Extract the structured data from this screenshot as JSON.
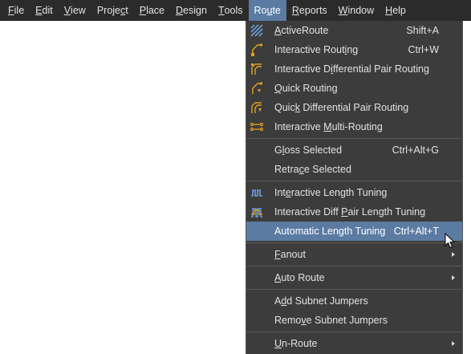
{
  "menubar": {
    "items": [
      {
        "pre": "",
        "ul": "F",
        "post": "ile"
      },
      {
        "pre": "",
        "ul": "E",
        "post": "dit"
      },
      {
        "pre": "",
        "ul": "V",
        "post": "iew"
      },
      {
        "pre": "Proje",
        "ul": "c",
        "post": "t"
      },
      {
        "pre": "",
        "ul": "P",
        "post": "lace"
      },
      {
        "pre": "",
        "ul": "D",
        "post": "esign"
      },
      {
        "pre": "",
        "ul": "T",
        "post": "ools"
      },
      {
        "pre": "Ro",
        "ul": "u",
        "post": "te"
      },
      {
        "pre": "",
        "ul": "R",
        "post": "eports"
      },
      {
        "pre": "",
        "ul": "W",
        "post": "indow"
      },
      {
        "pre": "",
        "ul": "H",
        "post": "elp"
      }
    ]
  },
  "route_menu": {
    "items": [
      {
        "pre": "",
        "ul": "A",
        "post": "ctiveRoute",
        "shortcut": "Shift+A",
        "icon": "active-route-icon"
      },
      {
        "pre": "Interactive Rout",
        "ul": "i",
        "post": "ng",
        "shortcut": "Ctrl+W",
        "icon": "interactive-routing-icon"
      },
      {
        "pre": "Interactive D",
        "ul": "i",
        "post": "fferential Pair Routing",
        "shortcut": "",
        "icon": "diff-pair-routing-icon"
      },
      {
        "pre": "",
        "ul": "Q",
        "post": "uick Routing",
        "shortcut": "",
        "icon": "quick-routing-icon"
      },
      {
        "pre": "Quic",
        "ul": "k",
        "post": " Differential Pair Routing",
        "shortcut": "",
        "icon": "quick-diff-pair-routing-icon"
      },
      {
        "pre": "Interactive ",
        "ul": "M",
        "post": "ulti-Routing",
        "shortcut": "",
        "icon": "multi-routing-icon"
      },
      {
        "pre": "G",
        "ul": "l",
        "post": "oss Selected",
        "shortcut": "Ctrl+Alt+G",
        "icon": ""
      },
      {
        "pre": "Retra",
        "ul": "c",
        "post": "e Selected",
        "shortcut": "",
        "icon": ""
      },
      {
        "pre": "Int",
        "ul": "e",
        "post": "ractive Length Tuning",
        "shortcut": "",
        "icon": "length-tuning-icon"
      },
      {
        "pre": "Interactive Diff ",
        "ul": "P",
        "post": "air Length Tuning",
        "shortcut": "",
        "icon": "diff-pair-length-tuning-icon"
      },
      {
        "pre": "Automatic Length Tuning",
        "ul": "",
        "post": "",
        "shortcut": "Ctrl+Alt+T",
        "icon": ""
      },
      {
        "pre": "",
        "ul": "F",
        "post": "anout",
        "shortcut": "",
        "icon": ""
      },
      {
        "pre": "",
        "ul": "A",
        "post": "uto Route",
        "shortcut": "",
        "icon": ""
      },
      {
        "pre": "A",
        "ul": "d",
        "post": "d Subnet Jumpers",
        "shortcut": "",
        "icon": ""
      },
      {
        "pre": "Remo",
        "ul": "v",
        "post": "e Subnet Jumpers",
        "shortcut": "",
        "icon": ""
      },
      {
        "pre": "",
        "ul": "U",
        "post": "n-Route",
        "shortcut": "",
        "icon": ""
      }
    ]
  },
  "colors": {
    "menubar_bg": "#2b2b2b",
    "menu_bg": "#3c3c3c",
    "highlight": "#5b7ba3",
    "icon_orange": "#e0a020",
    "icon_blue": "#6aa0e0"
  }
}
